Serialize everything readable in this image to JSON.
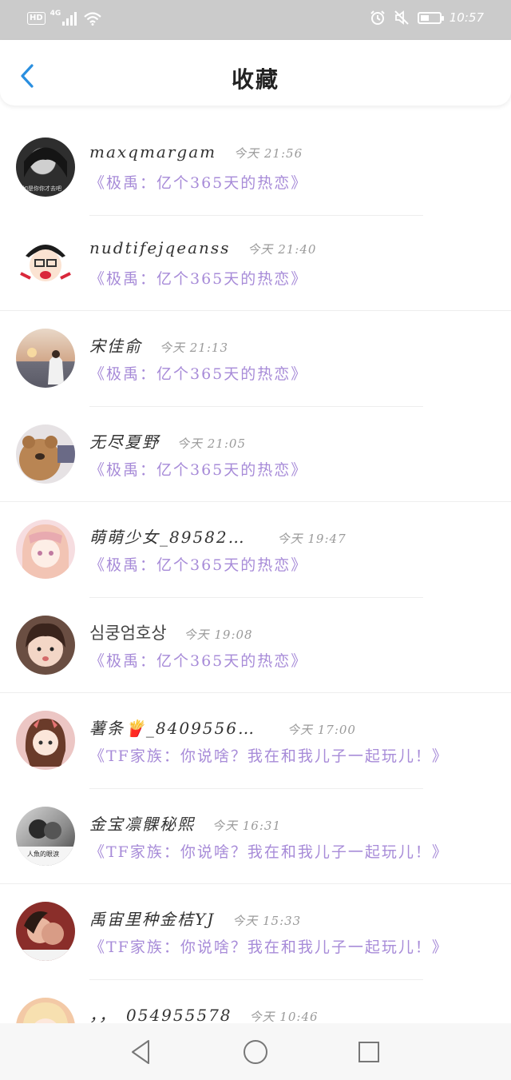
{
  "status_bar": {
    "hd": "HD",
    "network": "4G",
    "time": "10:57"
  },
  "nav": {
    "title": "收藏",
    "back_icon": "chevron-left-icon"
  },
  "favorites": [
    {
      "name": "maxqmargam",
      "time": "今天  21:56",
      "title": "《极禹：亿个365天的热恋》",
      "avatar_color": "#3a3a3a"
    },
    {
      "name": "nudtifejqeanss",
      "time": "今天  21:40",
      "title": "《极禹：亿个365天的热恋》",
      "avatar_color": "#d9283b"
    },
    {
      "name": "宋佳俞",
      "time": "今天  21:13",
      "title": "《极禹：亿个365天的热恋》",
      "avatar_color": "#b58a6a"
    },
    {
      "name": "无尽夏野",
      "time": "今天  21:05",
      "title": "《极禹：亿个365天的热恋》",
      "avatar_color": "#c49566"
    },
    {
      "name": "萌萌少女_89582…",
      "time": "今天  19:47",
      "title": "《极禹：亿个365天的热恋》",
      "avatar_color": "#f0c4c8"
    },
    {
      "name": "심쿵엄호상",
      "time": "今天  19:08",
      "title": "《极禹：亿个365天的热恋》",
      "avatar_color": "#7a5a4a"
    },
    {
      "name": "薯条🍟_8409556…",
      "time": "今天  17:00",
      "title": "《TF家族：你说啥？我在和我儿子一起玩儿！》",
      "avatar_color": "#d8a0a0"
    },
    {
      "name": "金宝凛髁秘熙",
      "time": "今天  16:31",
      "title": "《TF家族：你说啥？我在和我儿子一起玩儿！》",
      "avatar_color": "#5a5a5a"
    },
    {
      "name": "禹宙里种金桔YJ",
      "time": "今天  15:33",
      "title": "《TF家族：你说啥？我在和我儿子一起玩儿！》",
      "avatar_color": "#a0302c"
    },
    {
      "name": "，，_054955578",
      "time": "今天  10:46",
      "title": "",
      "avatar_color": "#f3c9a6"
    }
  ],
  "avatar_captions": {
    "first": "如是你你才去吧",
    "eighth": "人魚的眼淚"
  },
  "system_nav": {
    "back": "triangle-back-icon",
    "home": "circle-home-icon",
    "recent": "square-recent-icon"
  }
}
